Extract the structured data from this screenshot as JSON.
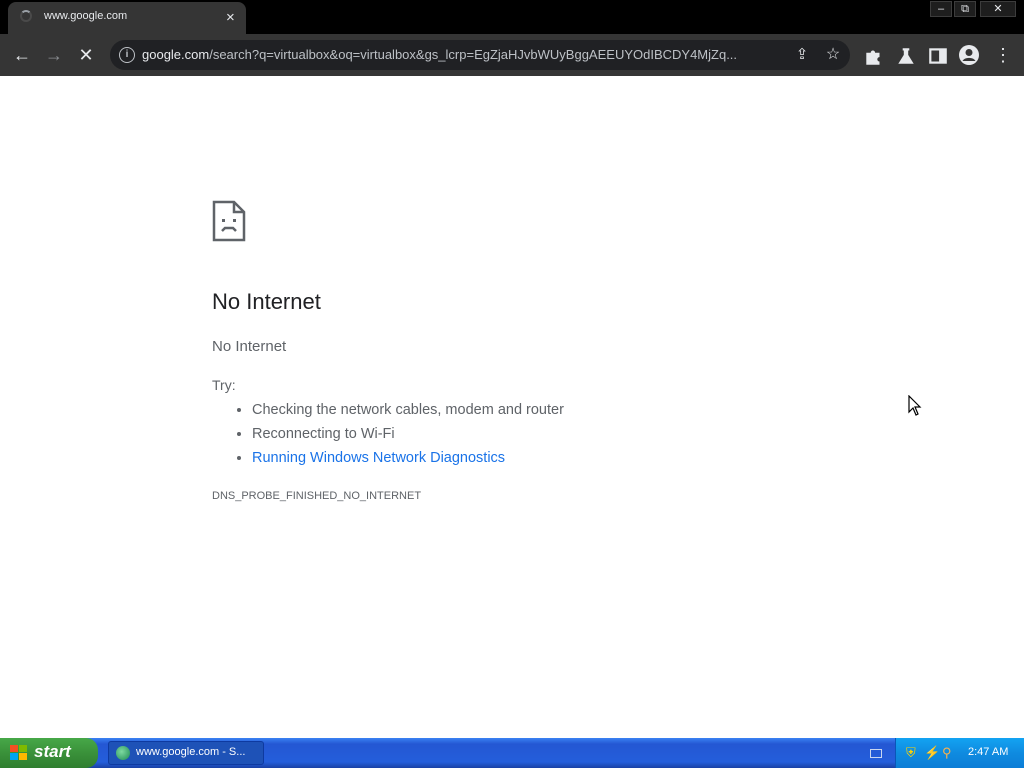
{
  "browser": {
    "tab_title": "www.google.com",
    "tab_close": "×",
    "window_controls": {
      "minimize": "–",
      "restore": "⧉",
      "close": "✕"
    },
    "url_host": "google.com",
    "url_path": "/search?q=virtualbox&oq=virtualbox&gs_lcrp=EgZjaHJvbWUyBggAEEUYOdIBCDY4MjZq..."
  },
  "error": {
    "title": "No Internet",
    "subtitle": "No Internet",
    "try_label": "Try:",
    "suggestions": [
      "Checking the network cables, modem and router",
      "Reconnecting to Wi-Fi",
      "Running Windows Network Diagnostics"
    ],
    "code": "DNS_PROBE_FINISHED_NO_INTERNET"
  },
  "taskbar": {
    "start_label": "start",
    "task_label": "www.google.com - S...",
    "clock": "2:47 AM"
  },
  "colors": {
    "link": "#1a73e8",
    "toolbar": "#353535",
    "taskbar": "#245edb"
  }
}
